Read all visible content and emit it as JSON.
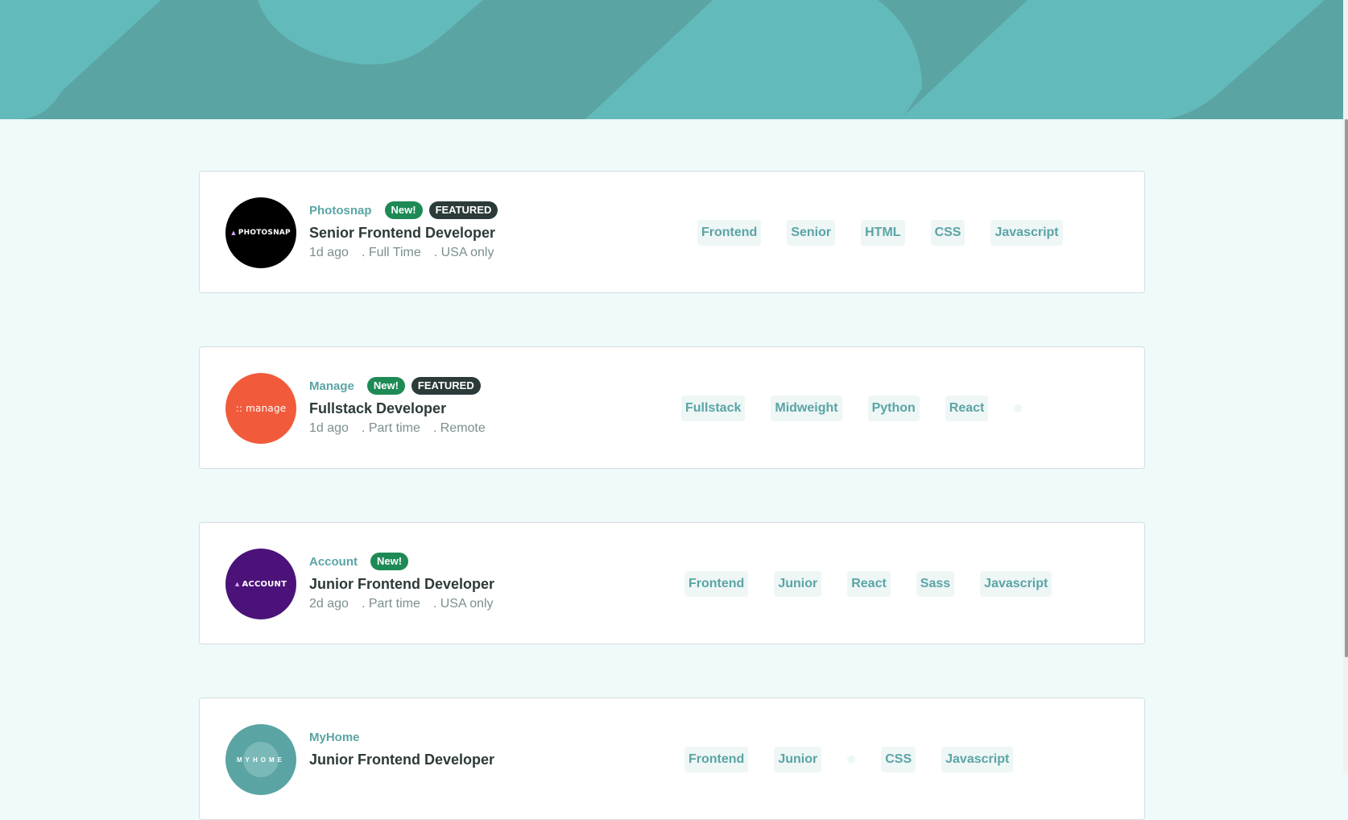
{
  "header": {
    "background_color": "#5ba4a4",
    "accent_color": "#63baba"
  },
  "jobs": [
    {
      "company": "Photosnap",
      "logo_text": "PHOTOSNAP",
      "logo_color": "#000000",
      "new_label": "New!",
      "featured_label": "FEATURED",
      "position": "Senior Frontend Developer",
      "posted": "1d ago",
      "contract": ". Full Time",
      "location": ". USA only",
      "tags": [
        "Frontend",
        "Senior",
        "HTML",
        "CSS",
        "Javascript"
      ]
    },
    {
      "company": "Manage",
      "logo_text": ":: manage",
      "logo_color": "#f15b3c",
      "new_label": "New!",
      "featured_label": "FEATURED",
      "position": "Fullstack Developer",
      "posted": "1d ago",
      "contract": ". Part time",
      "location": ". Remote",
      "tags": [
        "Fullstack",
        "Midweight",
        "Python",
        "React"
      ]
    },
    {
      "company": "Account",
      "logo_text": "ACCOUNT",
      "logo_color": "#4b1379",
      "new_label": "New!",
      "position": "Junior Frontend Developer",
      "posted": "2d ago",
      "contract": ". Part time",
      "location": ". USA only",
      "tags": [
        "Frontend",
        "Junior",
        "React",
        "Sass",
        "Javascript"
      ]
    },
    {
      "company": "MyHome",
      "logo_text": "MYHOME",
      "logo_color": "#5ba4a4",
      "position": "Junior Frontend Developer",
      "tags": [
        "Frontend",
        "Junior",
        "CSS",
        "Javascript"
      ]
    }
  ]
}
